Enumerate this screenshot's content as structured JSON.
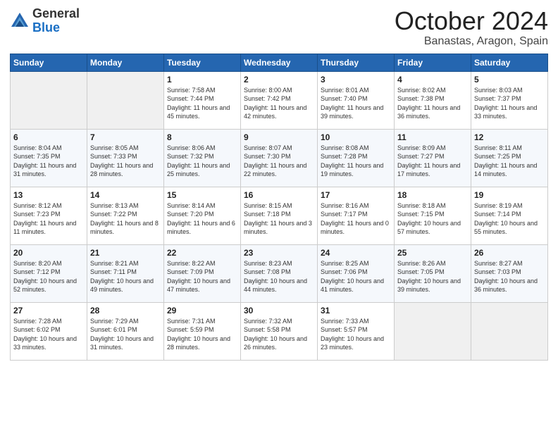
{
  "header": {
    "logo_general": "General",
    "logo_blue": "Blue",
    "month": "October 2024",
    "location": "Banastas, Aragon, Spain"
  },
  "weekdays": [
    "Sunday",
    "Monday",
    "Tuesday",
    "Wednesday",
    "Thursday",
    "Friday",
    "Saturday"
  ],
  "weeks": [
    [
      {
        "day": "",
        "sunrise": "",
        "sunset": "",
        "daylight": ""
      },
      {
        "day": "",
        "sunrise": "",
        "sunset": "",
        "daylight": ""
      },
      {
        "day": "1",
        "sunrise": "Sunrise: 7:58 AM",
        "sunset": "Sunset: 7:44 PM",
        "daylight": "Daylight: 11 hours and 45 minutes."
      },
      {
        "day": "2",
        "sunrise": "Sunrise: 8:00 AM",
        "sunset": "Sunset: 7:42 PM",
        "daylight": "Daylight: 11 hours and 42 minutes."
      },
      {
        "day": "3",
        "sunrise": "Sunrise: 8:01 AM",
        "sunset": "Sunset: 7:40 PM",
        "daylight": "Daylight: 11 hours and 39 minutes."
      },
      {
        "day": "4",
        "sunrise": "Sunrise: 8:02 AM",
        "sunset": "Sunset: 7:38 PM",
        "daylight": "Daylight: 11 hours and 36 minutes."
      },
      {
        "day": "5",
        "sunrise": "Sunrise: 8:03 AM",
        "sunset": "Sunset: 7:37 PM",
        "daylight": "Daylight: 11 hours and 33 minutes."
      }
    ],
    [
      {
        "day": "6",
        "sunrise": "Sunrise: 8:04 AM",
        "sunset": "Sunset: 7:35 PM",
        "daylight": "Daylight: 11 hours and 31 minutes."
      },
      {
        "day": "7",
        "sunrise": "Sunrise: 8:05 AM",
        "sunset": "Sunset: 7:33 PM",
        "daylight": "Daylight: 11 hours and 28 minutes."
      },
      {
        "day": "8",
        "sunrise": "Sunrise: 8:06 AM",
        "sunset": "Sunset: 7:32 PM",
        "daylight": "Daylight: 11 hours and 25 minutes."
      },
      {
        "day": "9",
        "sunrise": "Sunrise: 8:07 AM",
        "sunset": "Sunset: 7:30 PM",
        "daylight": "Daylight: 11 hours and 22 minutes."
      },
      {
        "day": "10",
        "sunrise": "Sunrise: 8:08 AM",
        "sunset": "Sunset: 7:28 PM",
        "daylight": "Daylight: 11 hours and 19 minutes."
      },
      {
        "day": "11",
        "sunrise": "Sunrise: 8:09 AM",
        "sunset": "Sunset: 7:27 PM",
        "daylight": "Daylight: 11 hours and 17 minutes."
      },
      {
        "day": "12",
        "sunrise": "Sunrise: 8:11 AM",
        "sunset": "Sunset: 7:25 PM",
        "daylight": "Daylight: 11 hours and 14 minutes."
      }
    ],
    [
      {
        "day": "13",
        "sunrise": "Sunrise: 8:12 AM",
        "sunset": "Sunset: 7:23 PM",
        "daylight": "Daylight: 11 hours and 11 minutes."
      },
      {
        "day": "14",
        "sunrise": "Sunrise: 8:13 AM",
        "sunset": "Sunset: 7:22 PM",
        "daylight": "Daylight: 11 hours and 8 minutes."
      },
      {
        "day": "15",
        "sunrise": "Sunrise: 8:14 AM",
        "sunset": "Sunset: 7:20 PM",
        "daylight": "Daylight: 11 hours and 6 minutes."
      },
      {
        "day": "16",
        "sunrise": "Sunrise: 8:15 AM",
        "sunset": "Sunset: 7:18 PM",
        "daylight": "Daylight: 11 hours and 3 minutes."
      },
      {
        "day": "17",
        "sunrise": "Sunrise: 8:16 AM",
        "sunset": "Sunset: 7:17 PM",
        "daylight": "Daylight: 11 hours and 0 minutes."
      },
      {
        "day": "18",
        "sunrise": "Sunrise: 8:18 AM",
        "sunset": "Sunset: 7:15 PM",
        "daylight": "Daylight: 10 hours and 57 minutes."
      },
      {
        "day": "19",
        "sunrise": "Sunrise: 8:19 AM",
        "sunset": "Sunset: 7:14 PM",
        "daylight": "Daylight: 10 hours and 55 minutes."
      }
    ],
    [
      {
        "day": "20",
        "sunrise": "Sunrise: 8:20 AM",
        "sunset": "Sunset: 7:12 PM",
        "daylight": "Daylight: 10 hours and 52 minutes."
      },
      {
        "day": "21",
        "sunrise": "Sunrise: 8:21 AM",
        "sunset": "Sunset: 7:11 PM",
        "daylight": "Daylight: 10 hours and 49 minutes."
      },
      {
        "day": "22",
        "sunrise": "Sunrise: 8:22 AM",
        "sunset": "Sunset: 7:09 PM",
        "daylight": "Daylight: 10 hours and 47 minutes."
      },
      {
        "day": "23",
        "sunrise": "Sunrise: 8:23 AM",
        "sunset": "Sunset: 7:08 PM",
        "daylight": "Daylight: 10 hours and 44 minutes."
      },
      {
        "day": "24",
        "sunrise": "Sunrise: 8:25 AM",
        "sunset": "Sunset: 7:06 PM",
        "daylight": "Daylight: 10 hours and 41 minutes."
      },
      {
        "day": "25",
        "sunrise": "Sunrise: 8:26 AM",
        "sunset": "Sunset: 7:05 PM",
        "daylight": "Daylight: 10 hours and 39 minutes."
      },
      {
        "day": "26",
        "sunrise": "Sunrise: 8:27 AM",
        "sunset": "Sunset: 7:03 PM",
        "daylight": "Daylight: 10 hours and 36 minutes."
      }
    ],
    [
      {
        "day": "27",
        "sunrise": "Sunrise: 7:28 AM",
        "sunset": "Sunset: 6:02 PM",
        "daylight": "Daylight: 10 hours and 33 minutes."
      },
      {
        "day": "28",
        "sunrise": "Sunrise: 7:29 AM",
        "sunset": "Sunset: 6:01 PM",
        "daylight": "Daylight: 10 hours and 31 minutes."
      },
      {
        "day": "29",
        "sunrise": "Sunrise: 7:31 AM",
        "sunset": "Sunset: 5:59 PM",
        "daylight": "Daylight: 10 hours and 28 minutes."
      },
      {
        "day": "30",
        "sunrise": "Sunrise: 7:32 AM",
        "sunset": "Sunset: 5:58 PM",
        "daylight": "Daylight: 10 hours and 26 minutes."
      },
      {
        "day": "31",
        "sunrise": "Sunrise: 7:33 AM",
        "sunset": "Sunset: 5:57 PM",
        "daylight": "Daylight: 10 hours and 23 minutes."
      },
      {
        "day": "",
        "sunrise": "",
        "sunset": "",
        "daylight": ""
      },
      {
        "day": "",
        "sunrise": "",
        "sunset": "",
        "daylight": ""
      }
    ]
  ]
}
